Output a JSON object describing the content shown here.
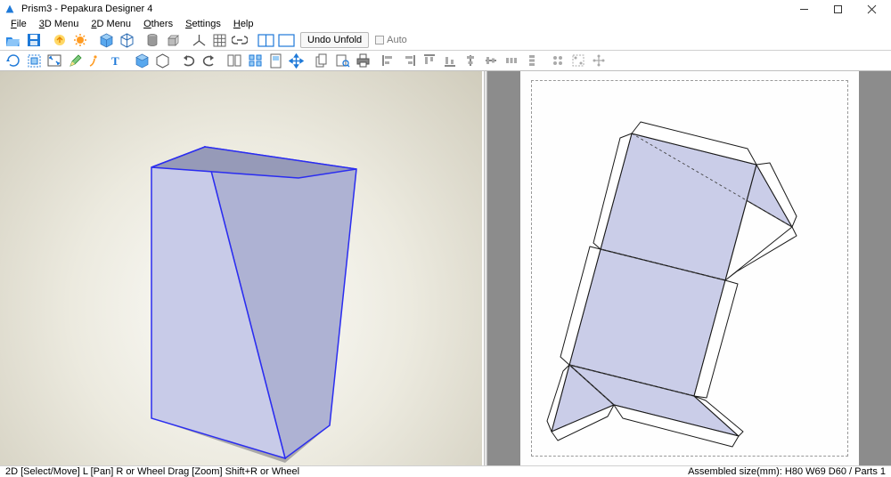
{
  "title": "Prism3 - Pepakura Designer 4",
  "menu": [
    "File",
    "3D Menu",
    "2D Menu",
    "Others",
    "Settings",
    "Help"
  ],
  "toolbar": {
    "undo_unfold": "Undo Unfold",
    "auto": "Auto"
  },
  "status": {
    "left": "2D [Select/Move] L [Pan] R or Wheel Drag [Zoom] Shift+R or Wheel",
    "right": "Assembled size(mm): H80 W69 D60 / Parts 1"
  },
  "colors": {
    "icon_blue": "#1e79d8",
    "icon_orange": "#ff9b22",
    "prism_fill": "#c5c8e6",
    "prism_edge": "#2b2df0",
    "unfold_fill": "#cacde8"
  }
}
